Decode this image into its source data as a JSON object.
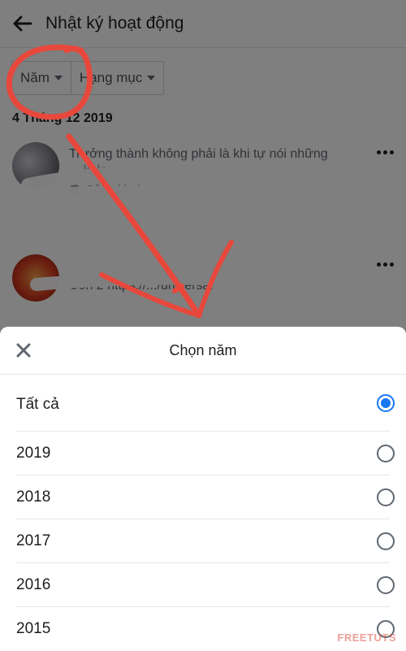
{
  "header": {
    "title": "Nhật ký hoạt động",
    "back_icon": "arrow-left-icon"
  },
  "filters": [
    {
      "label": "Năm",
      "icon": "caret-down-icon"
    },
    {
      "label": "Hạng mục",
      "icon": "caret-down-icon"
    }
  ],
  "date_header": "4 Tháng 12 2019",
  "posts": [
    {
      "text": "Trưởng thành không phải là khi tự nói những",
      "sub": "... lo lo ...",
      "privacy": "Công khai",
      "privacy_icon": "globe-icon",
      "more_icon": "more-icon"
    },
    {
      "text": "Con 2 https://.../universal",
      "more_icon": "more-icon"
    }
  ],
  "sheet": {
    "title": "Chọn năm",
    "close_icon": "close-icon",
    "options": [
      {
        "label": "Tất cả",
        "selected": true
      },
      {
        "label": "2019",
        "selected": false
      },
      {
        "label": "2018",
        "selected": false
      },
      {
        "label": "2017",
        "selected": false
      },
      {
        "label": "2016",
        "selected": false
      },
      {
        "label": "2015",
        "selected": false
      }
    ]
  },
  "colors": {
    "accent": "#1877f2",
    "annotation": "#e8473c",
    "text": "#1c1e21",
    "muted": "#90949c"
  },
  "watermark": "FREETUTS"
}
